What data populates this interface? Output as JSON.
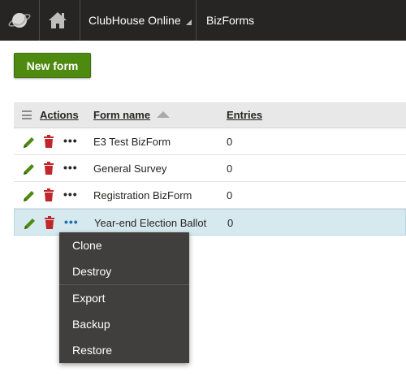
{
  "header": {
    "site_name": "ClubHouse Online",
    "app_name": "BizForms"
  },
  "toolbar": {
    "new_form_label": "New form"
  },
  "grid": {
    "columns": {
      "actions": "Actions",
      "form_name": "Form name",
      "entries": "Entries"
    },
    "sort": {
      "column": "form_name",
      "direction": "ascending"
    },
    "rows": [
      {
        "form_name": "E3 Test BizForm",
        "entries": "0"
      },
      {
        "form_name": "General Survey",
        "entries": "0"
      },
      {
        "form_name": "Registration BizForm",
        "entries": "0"
      },
      {
        "form_name": "Year-end Election Ballot",
        "entries": "0"
      }
    ],
    "selected_row": 3
  },
  "context_menu": {
    "items": [
      "Clone",
      "Destroy",
      "Export",
      "Backup",
      "Restore"
    ]
  },
  "colors": {
    "header_bg": "#262524",
    "primary_button": "#4f8a10",
    "edit_icon": "#4f8a10",
    "delete_icon": "#c0262b",
    "selected_row_bg": "#d6e9ef",
    "menu_bg": "#403f3e"
  }
}
